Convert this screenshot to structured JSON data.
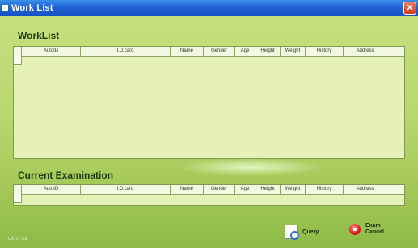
{
  "window": {
    "title": "Work List",
    "close_glyph": "✕"
  },
  "worklist": {
    "title": "WorkList",
    "columns": [
      "AutoID",
      "I.D.card",
      "Name",
      "Gender",
      "Age",
      "Height",
      "Weight",
      "History",
      "Address"
    ]
  },
  "exam": {
    "title": "Current Examination",
    "columns": [
      "AutoID",
      "I.D.card",
      "Name",
      "Gender",
      "Age",
      "Height",
      "Weight",
      "History",
      "Address"
    ]
  },
  "buttons": {
    "query": "Query",
    "exam_cancel": "Exam\nCancel"
  },
  "status": {
    "text": "OK  17:38"
  },
  "colors": {
    "titlebar": "#1f63d6",
    "panel": "#b9d870",
    "grid_bg": "#e6f1b8"
  },
  "icons": {
    "query": "magnifier-document-icon",
    "cancel": "stop-icon",
    "close": "close-icon"
  }
}
